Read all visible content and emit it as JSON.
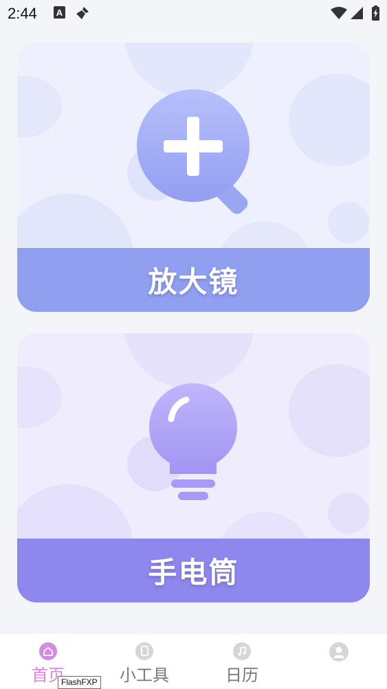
{
  "status_bar": {
    "time": "2:44"
  },
  "cards": [
    {
      "label": "放大镜",
      "icon": "magnifier-plus-icon",
      "accent": "#919ff0"
    },
    {
      "label": "手电筒",
      "icon": "lightbulb-icon",
      "accent": "#8e87ee"
    }
  ],
  "bottom_nav": {
    "items": [
      {
        "label": "首页",
        "icon": "home-icon",
        "active": true
      },
      {
        "label": "小工具",
        "icon": "tools-icon",
        "active": false
      },
      {
        "label": "日历",
        "icon": "music-note-icon",
        "active": false
      },
      {
        "label": "",
        "icon": "profile-icon",
        "active": false
      }
    ],
    "active_color": "#d987e3"
  },
  "tooltip": "FlashFXP"
}
